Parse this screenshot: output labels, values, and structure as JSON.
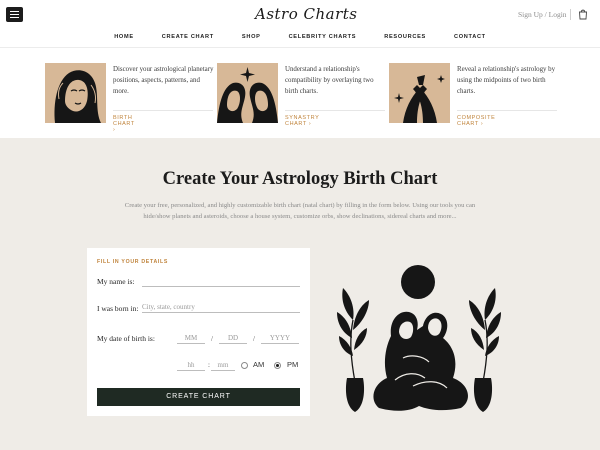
{
  "header": {
    "logo_text": "Astro Charts",
    "auth_label": "Sign Up / Login",
    "menu_icon": "hamburger-menu-icon",
    "cart_icon": "shopping-bag-icon"
  },
  "nav": {
    "items": [
      "HOME",
      "CREATE CHART",
      "SHOP",
      "CELEBRITY CHARTS",
      "RESOURCES",
      "CONTACT"
    ]
  },
  "features": [
    {
      "description": "Discover your astrological planetary positions, aspects, patterns, and more.",
      "link_label": "BIRTH CHART",
      "image_icon": "woman-portrait-illustration"
    },
    {
      "description": "Understand a relationship's compatibility by overlaying two birth charts.",
      "link_label": "SYNASTRY CHART",
      "image_icon": "couple-faces-star-illustration"
    },
    {
      "description": "Reveal a relationship's astrology by using the midpoints of two birth charts.",
      "link_label": "COMPOSITE CHART",
      "image_icon": "joined-hands-illustration"
    }
  ],
  "main": {
    "title": "Create Your Astrology Birth Chart",
    "subtitle": "Create your free, personalized, and highly customizable birth chart (natal chart) by filling in the form below. Using our tools you can hide/show planets and asteroids, choose a house system, customize orbs, show declinations, sidereal charts and more..."
  },
  "form": {
    "eyebrow": "FILL IN YOUR DETAILS",
    "name_label": "My name is:",
    "name_value": "",
    "born_label": "I was born in:",
    "born_placeholder": "City, state, country",
    "dob_label": "My date of birth is:",
    "month_placeholder": "MM",
    "day_placeholder": "DD",
    "year_placeholder": "YYYY",
    "date_separator": "/",
    "hour_placeholder": "hh",
    "minute_placeholder": "mm",
    "time_separator": ":",
    "am_label": "AM",
    "pm_label": "PM",
    "selected_meridiem": "PM",
    "submit_label": "CREATE CHART"
  },
  "colors": {
    "accent": "#c0843c",
    "button": "#1f2a23",
    "section_bg": "#efece7",
    "card_image_bg": "#d7b897"
  }
}
